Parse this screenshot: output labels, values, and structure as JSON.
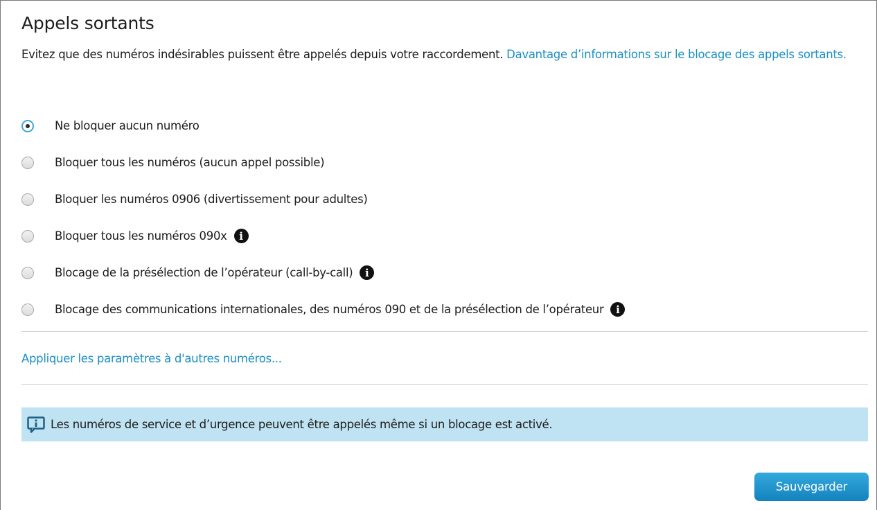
{
  "section": {
    "title": "Appels sortants",
    "intro_text": "Evitez que des numéros indésirables puissent être appelés depuis votre raccordement. ",
    "intro_link": "Davantage d’informations sur le blocage des appels sortants."
  },
  "options": [
    {
      "label": "Ne bloquer aucun numéro",
      "selected": true,
      "info": false
    },
    {
      "label": "Bloquer tous les numéros (aucun appel possible)",
      "selected": false,
      "info": false
    },
    {
      "label": "Bloquer les numéros 0906 (divertissement pour adultes)",
      "selected": false,
      "info": false
    },
    {
      "label": "Bloquer tous les numéros 090x",
      "selected": false,
      "info": true
    },
    {
      "label": "Blocage de la présélection de l’opérateur (call-by-call)",
      "selected": false,
      "info": true
    },
    {
      "label": "Blocage des communications internationales, des numéros 090 et de la présélection de l’opérateur",
      "selected": false,
      "info": true
    }
  ],
  "apply_link": "Appliquer les paramètres à d'autres numéros...",
  "notice": {
    "icon": "info-speech-bubble-icon",
    "text": "Les numéros de service et d’urgence peuvent être appelés même si un blocage est activé."
  },
  "buttons": {
    "save": "Sauvegarder"
  },
  "colors": {
    "link": "#1a8fc6",
    "notice_bg": "#bfe3f2",
    "button": "#1f95cf",
    "radio_selected_ring": "#3ea6d9"
  }
}
